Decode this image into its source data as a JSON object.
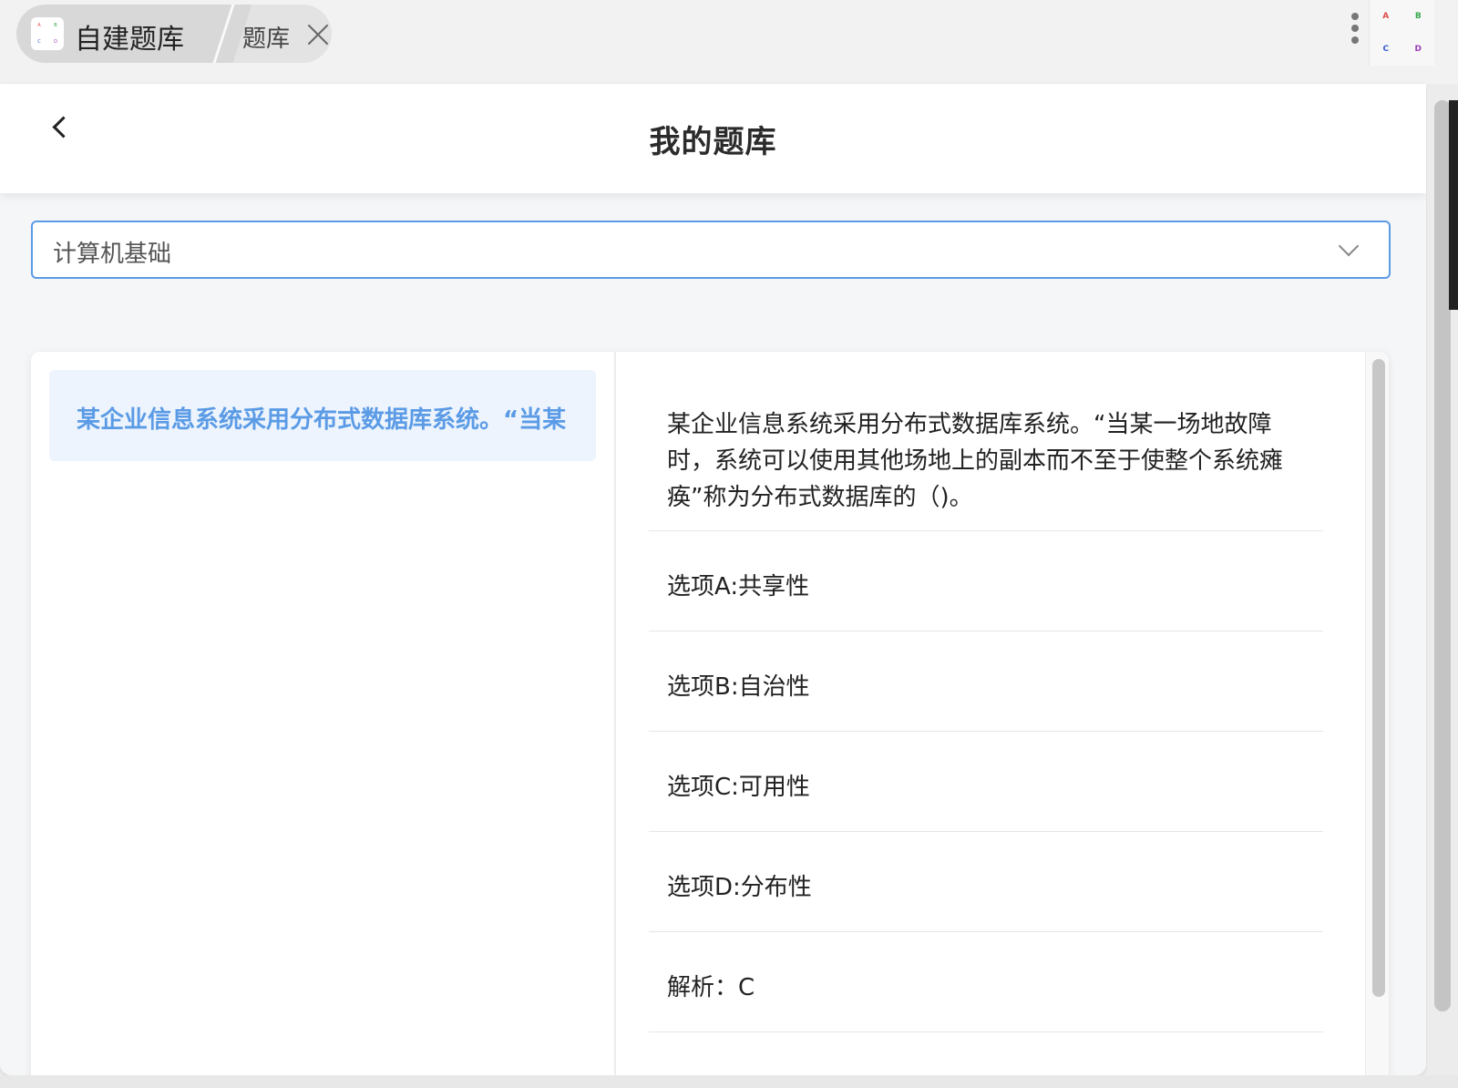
{
  "tab_bar": {
    "app_icon_letters": [
      "A",
      "B",
      "C",
      "D"
    ],
    "active_tab_title": "自建题库",
    "second_tab_title": "题库"
  },
  "header": {
    "title": "我的题库"
  },
  "category_select": {
    "value": "计算机基础"
  },
  "question_list": [
    {
      "text": "某企业信息系统采用分布式数据库系统。“当某"
    }
  ],
  "detail": {
    "question": "某企业信息系统采用分布式数据库系统。“当某一场地故障时，系统可以使用其他场地上的副本而不至于使整个系统瘫痪”称为分布式数据库的（)。",
    "options": [
      "选项A:共享性",
      "选项B:自治性",
      "选项C:可用性",
      "选项D:分布性"
    ],
    "analysis": "解析：C"
  },
  "icons": {
    "back": "back-arrow-icon",
    "close": "close-icon",
    "dropdown": "chevron-down-icon",
    "more": "more-vertical-icon"
  },
  "colors": {
    "accent": "#5b9be6",
    "selected_item_bg": "#edf4fd"
  }
}
